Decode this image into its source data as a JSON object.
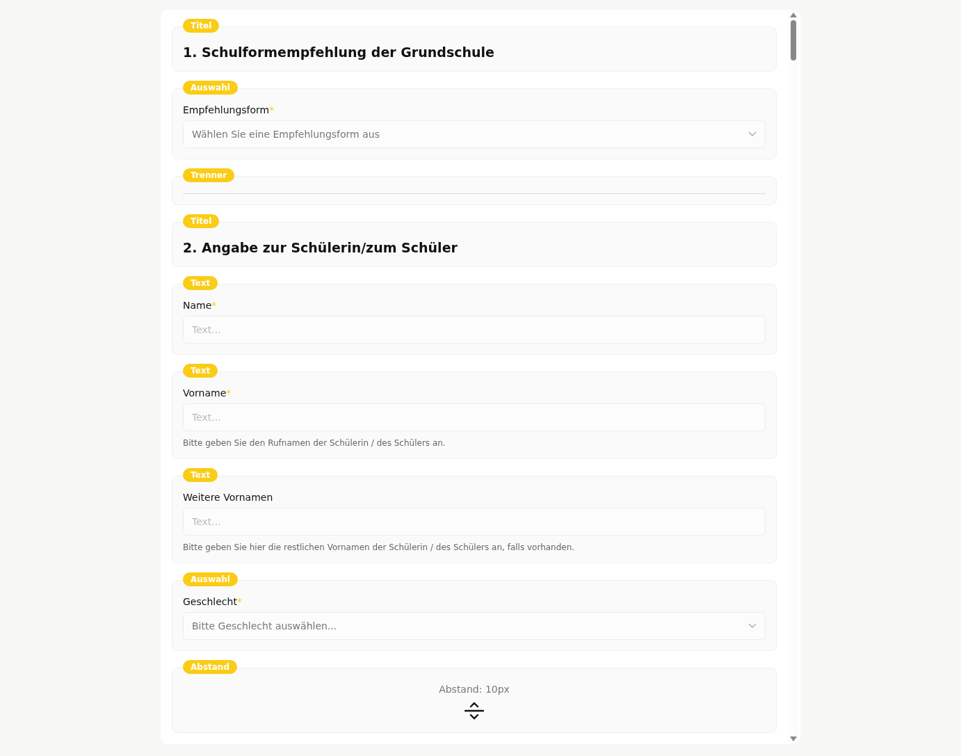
{
  "fields": [
    {
      "kind": "title",
      "badge": "Titel",
      "text": "1. Schulformempfehlung der Grundschule"
    },
    {
      "kind": "select",
      "badge": "Auswahl",
      "label": "Empfehlungsform",
      "required_mark": "*",
      "placeholder": "Wählen Sie eine Empfehlungsform aus"
    },
    {
      "kind": "divider",
      "badge": "Trenner"
    },
    {
      "kind": "title",
      "badge": "Titel",
      "text": "2. Angabe zur Schülerin/zum Schüler"
    },
    {
      "kind": "text",
      "badge": "Text",
      "label": "Name",
      "required_mark": "*",
      "placeholder": "Text..."
    },
    {
      "kind": "text",
      "badge": "Text",
      "label": "Vorname",
      "required_mark": "*",
      "placeholder": "Text...",
      "hint": "Bitte geben Sie den Rufnamen der Schülerin / des Schülers an."
    },
    {
      "kind": "text",
      "badge": "Text",
      "label": "Weitere Vornamen",
      "placeholder": "Text...",
      "hint": "Bitte geben Sie hier die restlichen Vornamen der Schülerin / des Schülers an, falls vorhanden."
    },
    {
      "kind": "select",
      "badge": "Auswahl",
      "label": "Geschlecht",
      "required_mark": "*",
      "placeholder": "Bitte Geschlecht auswählen..."
    },
    {
      "kind": "spacing",
      "badge": "Abstand",
      "text": "Abstand: 10px"
    }
  ]
}
